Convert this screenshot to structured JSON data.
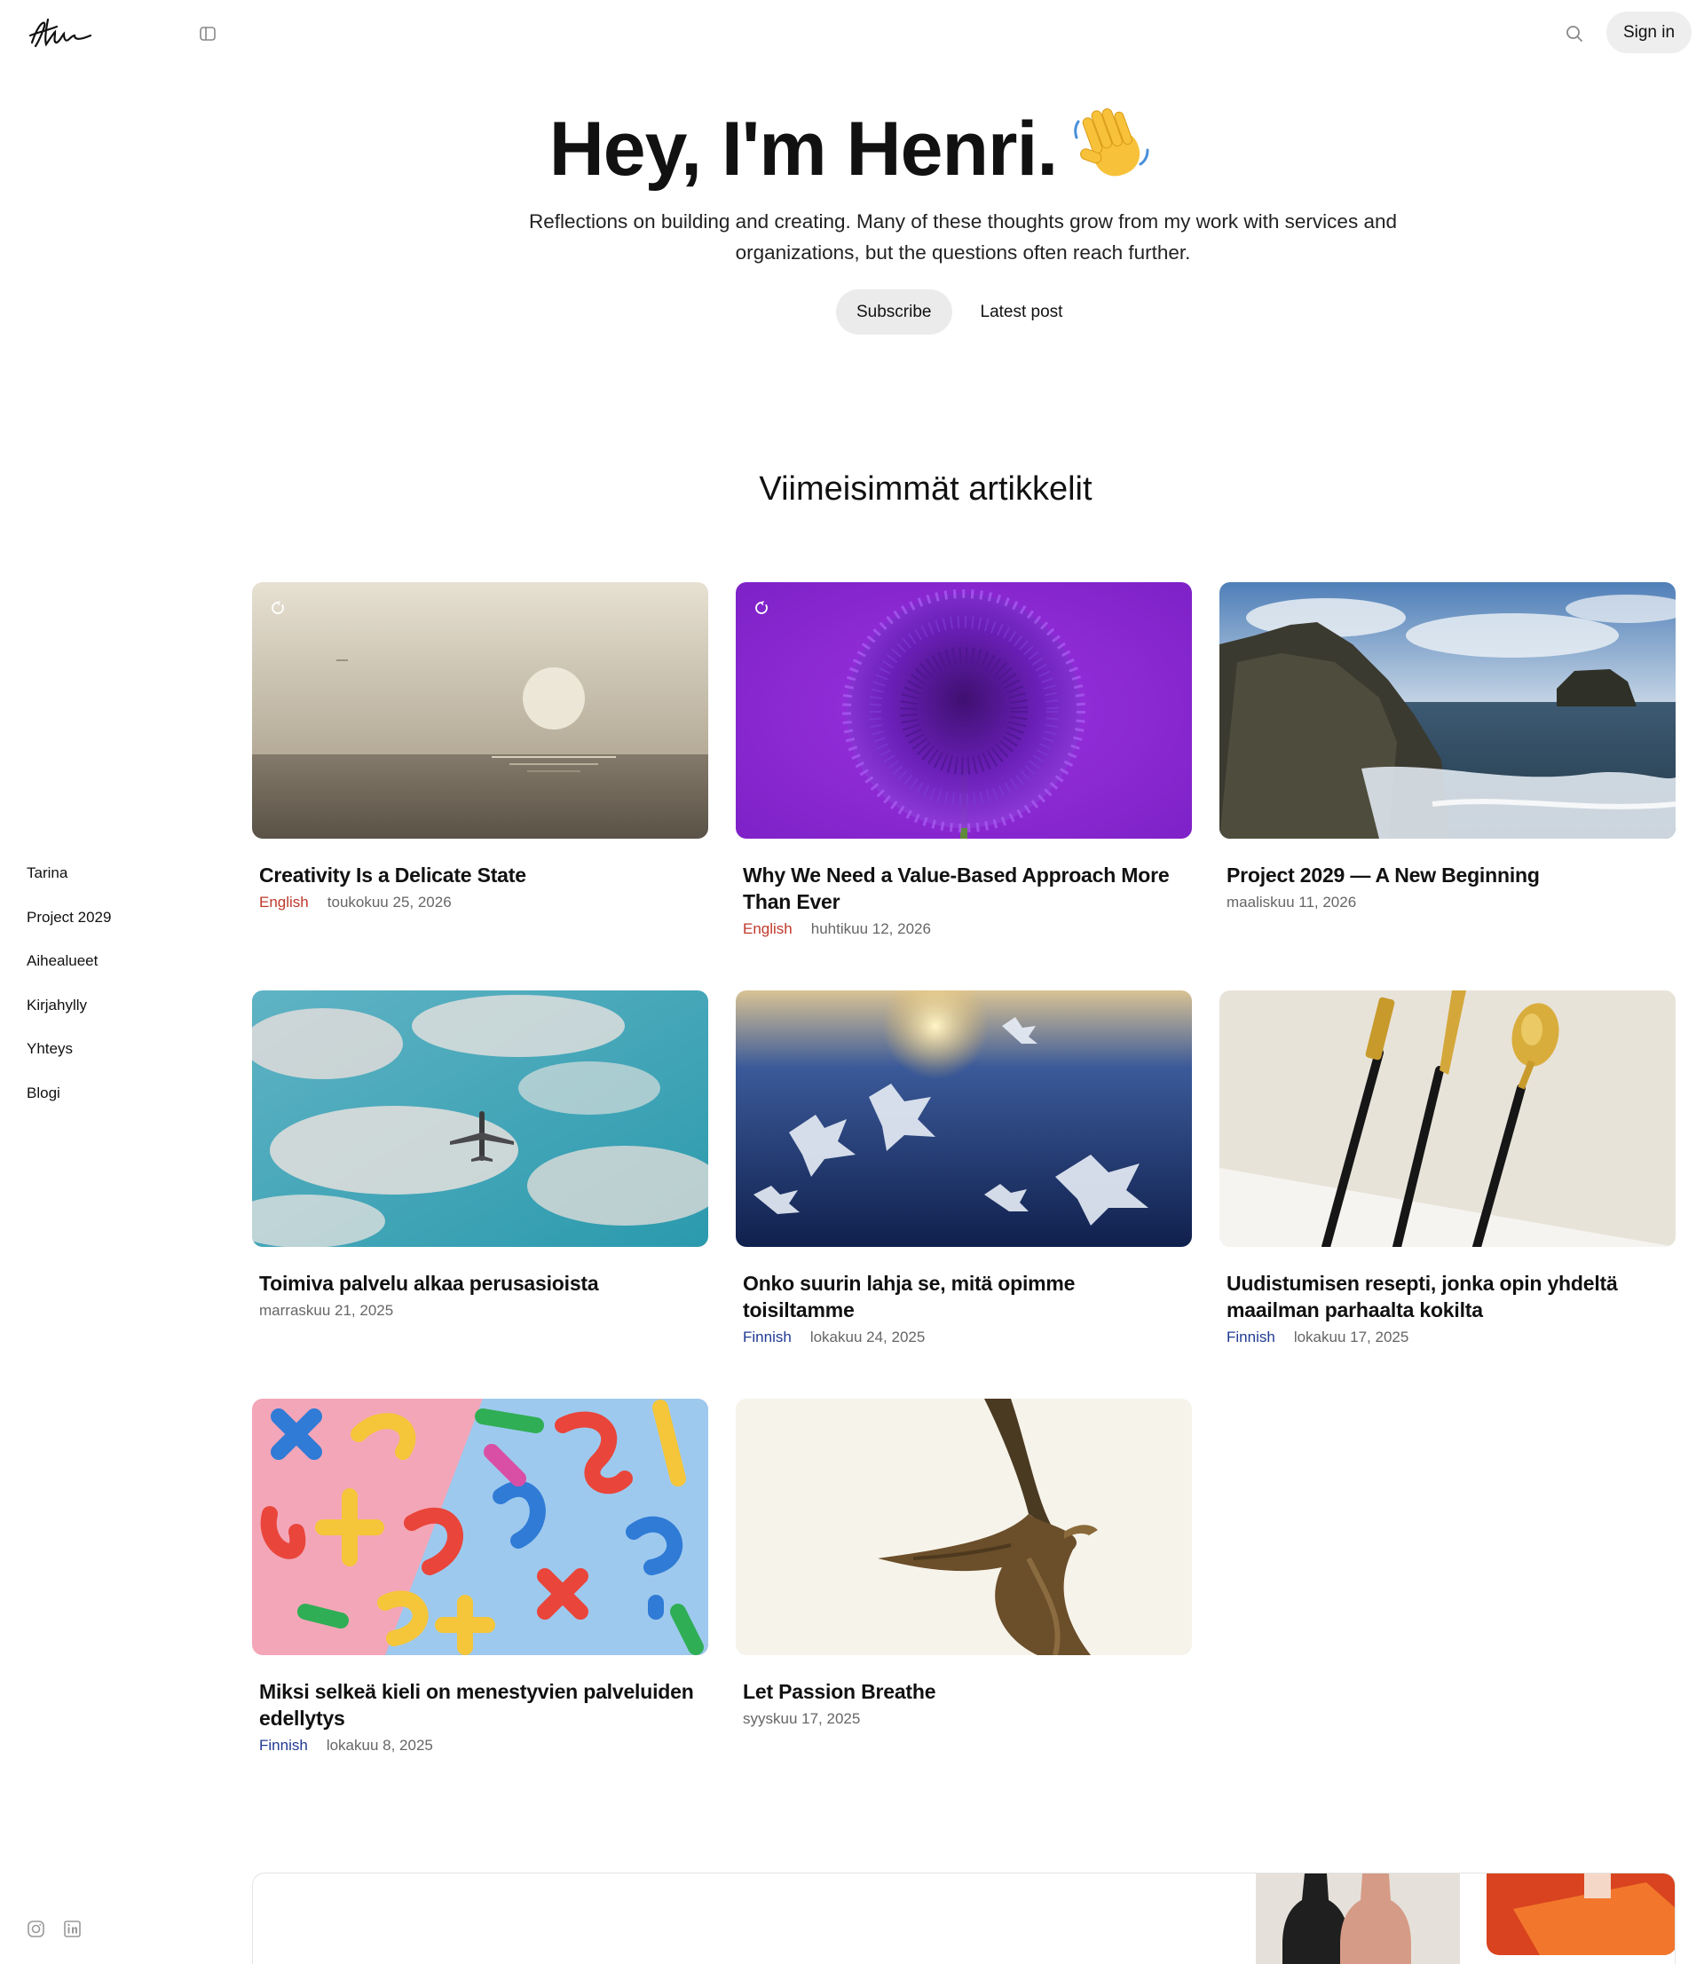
{
  "header": {
    "logo_text": "Hlw",
    "signin_label": "Sign in"
  },
  "hero": {
    "title": "Hey, I'm Henri.",
    "subtitle": "Reflections on building and creating. Many of these thoughts grow from my work with services and organizations, but the questions often reach further.",
    "subscribe_label": "Subscribe",
    "latest_label": "Latest post"
  },
  "nav": {
    "items": [
      {
        "label": "Tarina"
      },
      {
        "label": "Project 2029"
      },
      {
        "label": "Aihealueet"
      },
      {
        "label": "Kirjahylly"
      },
      {
        "label": "Yhteys"
      },
      {
        "label": "Blogi"
      }
    ]
  },
  "section_title": "Viimeisimmät artikkelit",
  "posts": [
    {
      "title": "Creativity Is a Delicate State",
      "lang": "English",
      "date": "toukokuu 25, 2026",
      "image": "sunset-sea"
    },
    {
      "title": "Why We Need a Value-Based Approach More Than Ever",
      "lang": "English",
      "date": "huhtikuu 12, 2026",
      "image": "purple-allium"
    },
    {
      "title": "Project 2029 — A New Beginning",
      "lang": "",
      "date": "maaliskuu 11, 2026",
      "image": "coastal-cliffs"
    },
    {
      "title": "Toimiva palvelu alkaa perusasioista",
      "lang": "",
      "date": "marraskuu 21, 2025",
      "image": "airplane-sky"
    },
    {
      "title": "Onko suurin lahja se, mitä opimme toisiltamme",
      "lang": "Finnish",
      "date": "lokakuu 24, 2025",
      "image": "frost-crystals"
    },
    {
      "title": "Uudistumisen resepti, jonka opin yhdeltä maailman parhaalta kokilta",
      "lang": "Finnish",
      "date": "lokakuu 17, 2025",
      "image": "gold-cutlery"
    },
    {
      "title": "Miksi selkeä kieli on menestyvien palveluiden edellytys",
      "lang": "Finnish",
      "date": "lokakuu 8, 2025",
      "image": "colorful-letters"
    },
    {
      "title": "Let Passion Breathe",
      "lang": "",
      "date": "syyskuu 17, 2025",
      "image": "flying-kite-bird"
    }
  ],
  "colors": {
    "english_tag": "#c0392b",
    "finnish_tag": "#1f3a93",
    "button_bg": "#ebebeb"
  },
  "icons": [
    "sidebar-toggle-icon",
    "search-icon",
    "waving-hand-icon",
    "loading-spinner-icon",
    "instagram-icon",
    "linkedin-icon"
  ]
}
